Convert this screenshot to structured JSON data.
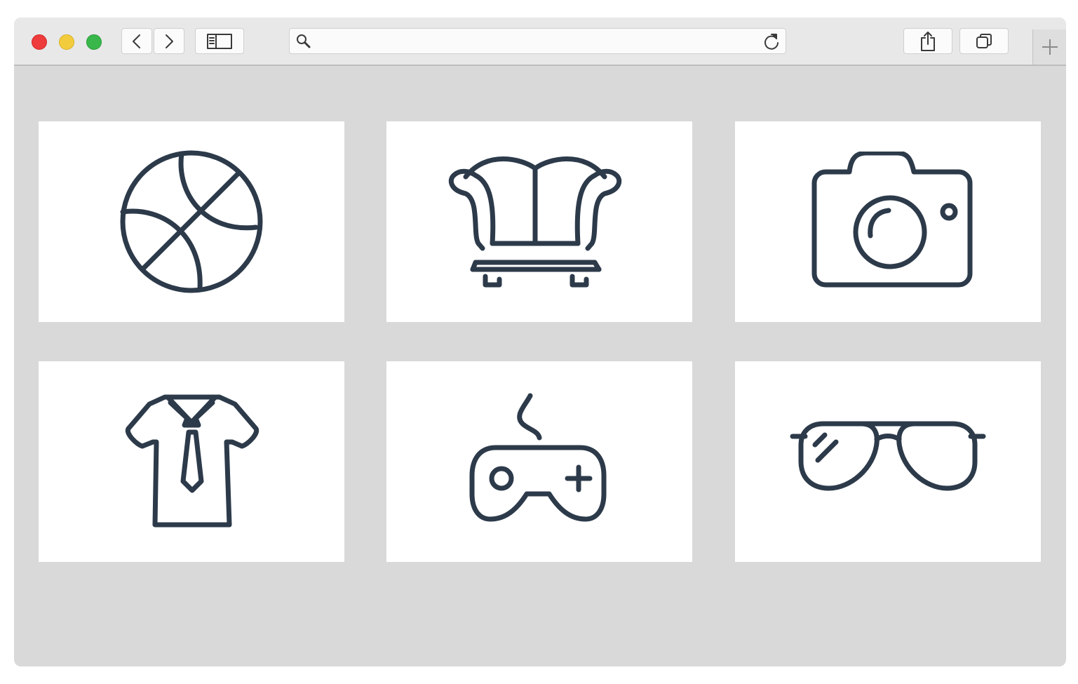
{
  "browser": {
    "address_bar": {
      "value": "",
      "placeholder": ""
    },
    "toolbar_icons": [
      "close-icon",
      "minimize-icon",
      "maximize-icon",
      "back-icon",
      "forward-icon",
      "sidebar-icon",
      "search-icon",
      "reload-icon",
      "share-icon",
      "tabs-icon",
      "plus-icon"
    ]
  },
  "colors": {
    "icon_stroke": "#2c3a4a",
    "window_bg": "#d9d9d9",
    "card_bg": "#ffffff",
    "close": "#ee3b3b",
    "minimize": "#f2cc3d",
    "maximize": "#39b74a"
  },
  "grid": {
    "cards": [
      {
        "icon": "basketball-icon"
      },
      {
        "icon": "armchair-icon"
      },
      {
        "icon": "camera-icon"
      },
      {
        "icon": "shirt-tie-icon"
      },
      {
        "icon": "gamepad-icon"
      },
      {
        "icon": "sunglasses-icon"
      }
    ]
  }
}
